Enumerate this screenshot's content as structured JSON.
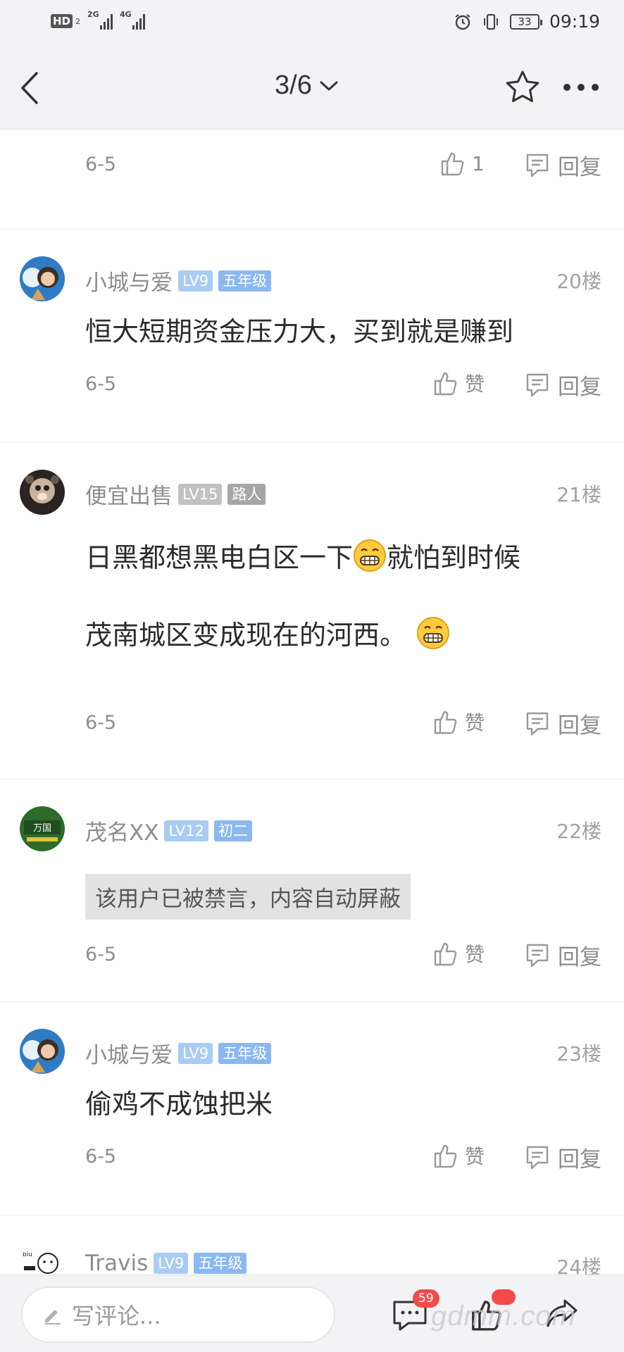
{
  "status_bar": {
    "hd_label": "HD",
    "hd_sub": "2",
    "net1": "2G",
    "net2": "4G",
    "battery": "33",
    "time": "09:19"
  },
  "nav": {
    "page_indicator": "3/6"
  },
  "first_post_tail": {
    "date": "6-5",
    "like_label": "1",
    "reply_label": "回复"
  },
  "posts": [
    {
      "username": "小城与爱",
      "level": "LV9",
      "tag": "五年级",
      "floor": "20楼",
      "lines": [
        "恒大短期资金压力大，买到就是赚到"
      ],
      "date": "6-5",
      "like_label": "赞",
      "reply_label": "回复"
    },
    {
      "username": "便宜出售",
      "level": "LV15",
      "tag": "路人",
      "floor": "21楼",
      "lines": [
        "日黑都想黑电白区一下",
        "就怕到时候",
        "茂南城区变成现在的河西。"
      ],
      "date": "6-5",
      "like_label": "赞",
      "reply_label": "回复"
    },
    {
      "username": "茂名XX",
      "level": "LV12",
      "tag": "初二",
      "floor": "22楼",
      "banned_text": "该用户已被禁言，内容自动屏蔽",
      "date": "6-5",
      "like_label": "赞",
      "reply_label": "回复"
    },
    {
      "username": "小城与爱",
      "level": "LV9",
      "tag": "五年级",
      "floor": "23楼",
      "lines": [
        "偷鸡不成蚀把米"
      ],
      "date": "6-5",
      "like_label": "赞",
      "reply_label": "回复"
    },
    {
      "username": "Travis",
      "level": "LV9",
      "tag": "五年级",
      "floor": "24楼"
    }
  ],
  "bottom_bar": {
    "comment_placeholder": "写评论...",
    "comment_count": "59",
    "watermark": "gdmm.com"
  },
  "colors": {
    "accent_blue": "#8bb8f0",
    "badge_red": "#f34b4b",
    "bar_bg": "#f3f3f5"
  }
}
